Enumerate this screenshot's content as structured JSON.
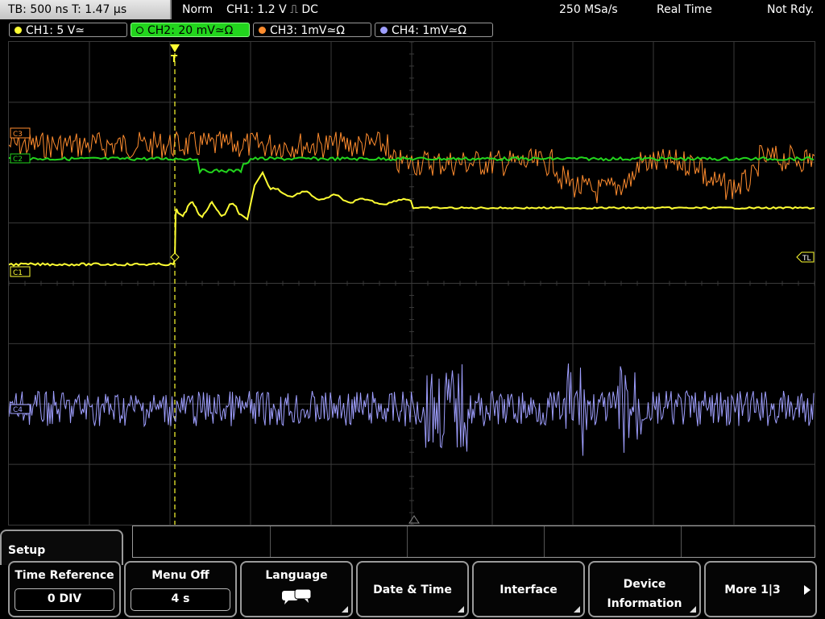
{
  "status_bar": {
    "timebase": "TB: 500 ns   T: 1.47 µs",
    "mode": "Norm",
    "trigger": "CH1: 1.2 V ⎍ DC",
    "sample_rate": "250 MSa/s",
    "acquisition": "Real Time",
    "state": "Not Rdy."
  },
  "channels": [
    {
      "label": "CH1: 5 V≃",
      "color": "#ffff33",
      "active": false
    },
    {
      "label": "CH2: 20 mV≃Ω",
      "color": "#22d51d",
      "active": true
    },
    {
      "label": "CH3: 1mV≃Ω",
      "color": "#ff8c2e",
      "active": false
    },
    {
      "label": "CH4: 1mV≃Ω",
      "color": "#9f9fff",
      "active": false
    }
  ],
  "markers": {
    "ch3": "C3",
    "ch1": "C1",
    "ch2": "C2",
    "ch4": "C4",
    "trigger_level": "TL",
    "trigger_pos": "T"
  },
  "menu": {
    "title": "Setup",
    "keys": [
      {
        "label": "Time Reference",
        "value": "0 DIV"
      },
      {
        "label": "Menu Off",
        "value": "4 s"
      },
      {
        "label": "Language",
        "icon": "speech-bubbles-icon"
      },
      {
        "label": "Date & Time"
      },
      {
        "label": "Interface"
      },
      {
        "label_line1": "Device",
        "label_line2": "Information"
      },
      {
        "label": "More 1|3"
      }
    ]
  },
  "colors": {
    "ch1": "#ffff33",
    "ch2": "#22d51d",
    "ch3": "#ff8c2e",
    "ch4": "#9f9fff",
    "grid": "#3a3a3a"
  }
}
